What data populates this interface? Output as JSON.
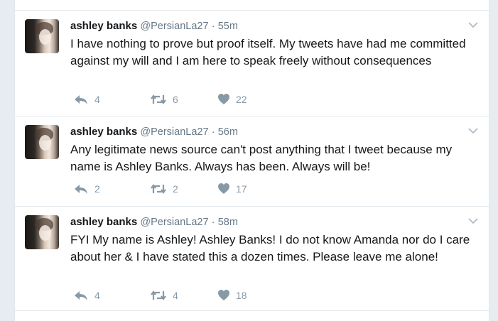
{
  "tweets": [
    {
      "name": "ashley banks",
      "handle": "@PersianLa27",
      "dot": "·",
      "time": "55m",
      "text": "I have nothing to prove but proof itself. My tweets have had me committed against my will and I am here to speak freely without consequences",
      "replies": "4",
      "retweets": "6",
      "likes": "22"
    },
    {
      "name": "ashley banks",
      "handle": "@PersianLa27",
      "dot": "·",
      "time": "56m",
      "text": "Any legitimate news source can't post anything that I tweet because my name is Ashley Banks. Always has been. Always will be!",
      "replies": "2",
      "retweets": "2",
      "likes": "17"
    },
    {
      "name": "ashley banks",
      "handle": "@PersianLa27",
      "dot": "·",
      "time": "58m",
      "text": "FYI My name is Ashley! Ashley Banks! I do not know Amanda nor do I care about her & I have stated this a dozen times. Please leave me alone!",
      "replies": "4",
      "retweets": "4",
      "likes": "18"
    }
  ],
  "colors": {
    "icon": "#8899a6",
    "text": "#14171a",
    "meta": "#657786",
    "border": "#e1e8ed"
  },
  "icons": {
    "reply": "reply-icon",
    "retweet": "retweet-icon",
    "like": "heart-icon",
    "more": "chevron-down-icon"
  }
}
